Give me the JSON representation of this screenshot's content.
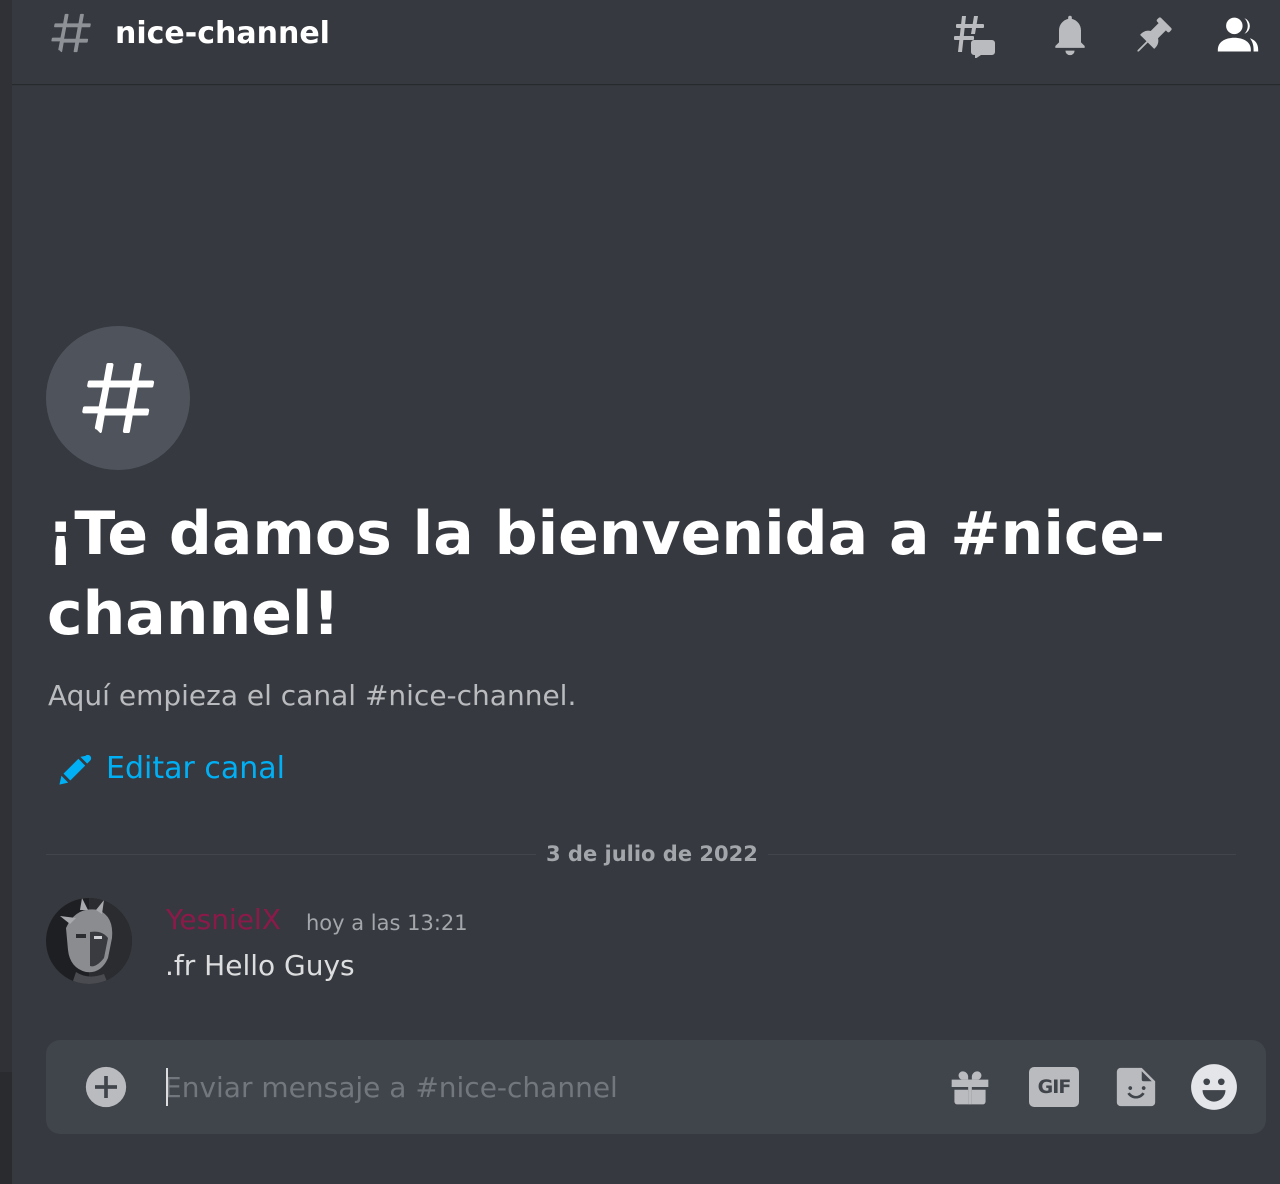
{
  "header": {
    "channel_name": "nice-channel",
    "icons": [
      "threads-icon",
      "bell-icon",
      "pin-icon",
      "members-icon"
    ]
  },
  "welcome": {
    "title": "¡Te damos la bienvenida a #nice-channel!",
    "subtitle": "Aquí empieza el canal #nice-channel.",
    "edit_label": "Editar canal"
  },
  "divider": {
    "date": "3 de julio de 2022"
  },
  "message": {
    "author": "YesnielX",
    "timestamp": "hoy a las 13:21",
    "text": ".fr Hello Guys",
    "author_color": "#8b1a4a"
  },
  "composer": {
    "placeholder": "Enviar mensaje a #nice-channel",
    "value": "",
    "gif_label": "GIF"
  },
  "colors": {
    "background": "#36393f",
    "composer": "#40444b",
    "link": "#00aff4",
    "muted_text": "#b9bbbe",
    "icon": "#b9bbbe"
  }
}
